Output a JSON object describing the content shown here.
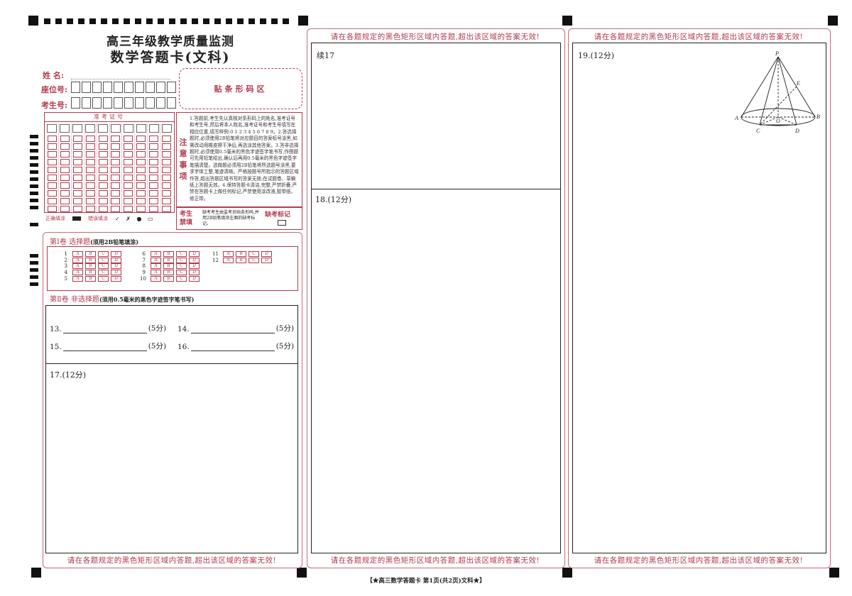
{
  "header": {
    "title_line1": "高三年级教学质量监测",
    "title_line2": "数学答题卡(文科)"
  },
  "student": {
    "name_label": "姓  名:",
    "seat_label": "座位号:",
    "exam_no_label": "考生号:",
    "barcode_area": "贴条形码区",
    "exam_id_header": "准考证号"
  },
  "notice": {
    "side_title": "注意事项",
    "text": "1.答题前,考生先认真核对条形码上的姓名,准考证号和考生号,然后将本人姓名,准考证号和考生号填写在相应位置,填写样例:0 1 2 3 4 5 6 7 8 9。2.答选择题时,必须使用2B铅笔将对应题目的答案标号涂黑,如需改动用橡皮擦干净后,再选涂其他答案。3.答非选择题时,必须使用0.5毫米的黑色字迹签字笔书写,作图题可先用铅笔绘出,确认后再用0.5毫米的黑色字迹签字笔描清楚。选做题必须用2B铅笔将所选题号涂黑,要求字体工整,笔迹清晰。严格按题号所指示的答题区域作答,超出答题区域书写的答案无效;在试题卷、草稿纸上答题无效。4.保持答题卡清洁,完整,严禁折叠,严禁在答题卡上做任何标记,严禁使用涂改液,胶带纸、修正带。"
  },
  "exam_flag": {
    "label": "考生禁填",
    "text": "缺考考生由监考员贴条形码,并用2B铅笔填涂左面的缺考标记。",
    "absent_label": "缺考标记"
  },
  "fill_sample": {
    "correct": "正确填涂",
    "wrong": "错误填涂"
  },
  "part1": {
    "title": "第Ⅰ卷  选择题",
    "note": "(须用2B铅笔填涂)",
    "options": [
      "A",
      "B",
      "C",
      "D"
    ],
    "groups": [
      [
        "1",
        "2",
        "3",
        "4",
        "5"
      ],
      [
        "6",
        "7",
        "8",
        "9",
        "10"
      ],
      [
        "11",
        "12"
      ]
    ]
  },
  "part2": {
    "title": "第Ⅱ卷  非选择题",
    "note": "(须用0.5毫米的黑色字迹签字笔书写)",
    "q13": "13.",
    "q14": "14.",
    "q15": "15.",
    "q16": "16.",
    "points5": "(5分)",
    "q17": "17.(12分)",
    "q17_cont": "续17",
    "q18": "18.(12分)",
    "q19": "19.(12分)"
  },
  "warning": "请在各题规定的黑色矩形区域内答题,超出该区域的答案无效!",
  "footer": "【★高三数学答题卡  第1页(共2页)文科★】",
  "figure": {
    "labels": [
      "P",
      "E",
      "A",
      "B",
      "C",
      "D",
      "O"
    ]
  },
  "colors": {
    "accent": "#b23a4e",
    "border": "#c86a7a"
  }
}
